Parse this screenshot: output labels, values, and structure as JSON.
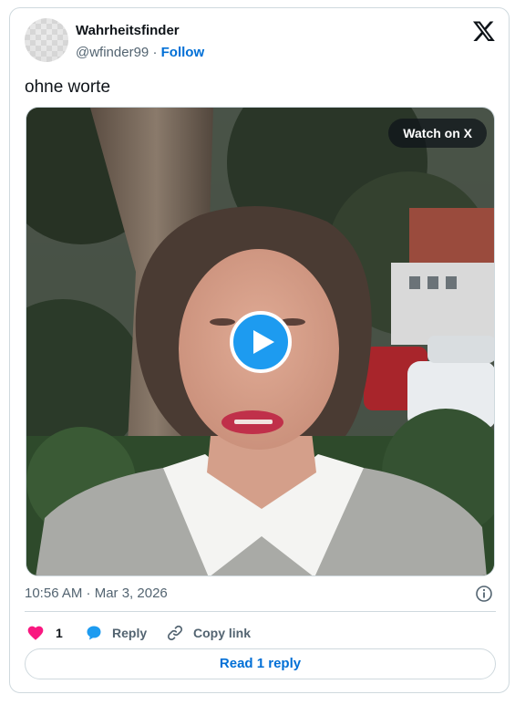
{
  "author": {
    "name": "Wahrheitsfinder",
    "handle": "@wfinder99",
    "separator": "·",
    "follow_label": "Follow"
  },
  "tweet": {
    "text": "ohne worte",
    "timestamp": "10:56 AM · Mar 3, 2026"
  },
  "media": {
    "watch_label": "Watch on X"
  },
  "actions": {
    "like_count": "1",
    "reply_label": "Reply",
    "copy_label": "Copy link"
  },
  "footer": {
    "read_replies_label": "Read 1 reply"
  },
  "colors": {
    "accent": "#1d9bf0",
    "link": "#006fd6",
    "like": "#f91880",
    "muted": "#536471"
  }
}
